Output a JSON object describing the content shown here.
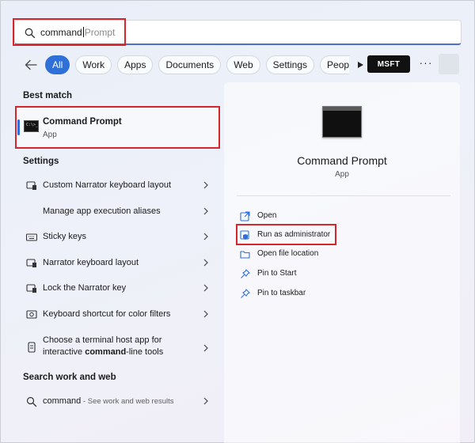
{
  "search": {
    "typed": "command",
    "suggestion": "Prompt"
  },
  "filters": {
    "chips": [
      "All",
      "Work",
      "Apps",
      "Documents",
      "Web",
      "Settings",
      "People"
    ],
    "active": "All",
    "org_badge": "MSFT",
    "more": "···"
  },
  "best_match": {
    "heading": "Best match",
    "title": "Command Prompt",
    "subtitle": "App"
  },
  "settings": {
    "heading": "Settings",
    "items": [
      {
        "label": "Custom Narrator keyboard layout",
        "icon": "narrator-keyboard-icon"
      },
      {
        "label": "Manage app execution aliases",
        "icon": ""
      },
      {
        "label": "Sticky keys",
        "icon": "keyboard-icon"
      },
      {
        "label": "Narrator keyboard layout",
        "icon": "narrator-keyboard-icon"
      },
      {
        "label": "Lock the Narrator key",
        "icon": "narrator-icon"
      },
      {
        "label": "Keyboard shortcut for color filters",
        "icon": "color-filter-icon"
      }
    ],
    "two_line_item": {
      "line1": "Choose a terminal host app for",
      "line2_pre": "interactive ",
      "line2_bold": "command",
      "line2_post": "-line tools",
      "icon": "terminal-settings-icon"
    }
  },
  "web": {
    "heading": "Search work and web",
    "query": "command",
    "hint": " - See work and web results"
  },
  "detail": {
    "title": "Command Prompt",
    "subtitle": "App",
    "actions": [
      {
        "label": "Open",
        "icon": "open-external-icon"
      },
      {
        "label": "Run as administrator",
        "icon": "shield-admin-icon"
      },
      {
        "label": "Open file location",
        "icon": "folder-icon"
      },
      {
        "label": "Pin to Start",
        "icon": "pin-icon"
      },
      {
        "label": "Pin to taskbar",
        "icon": "pin-icon"
      }
    ]
  },
  "colors": {
    "accent": "#2f6fd8",
    "highlight_box": "#d3272c"
  }
}
